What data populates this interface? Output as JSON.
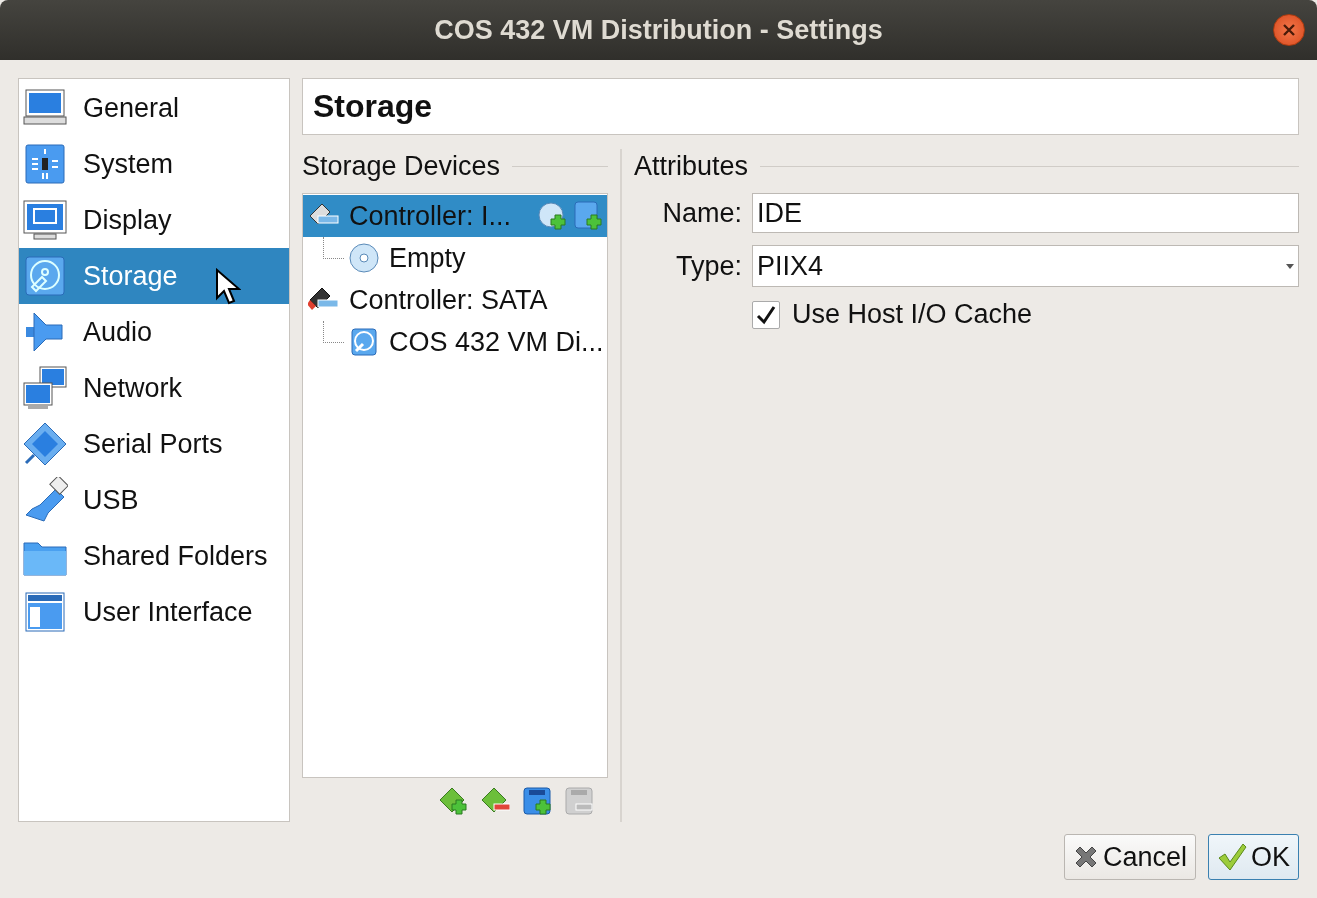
{
  "window": {
    "title": "COS 432 VM Distribution - Settings"
  },
  "sidebar": {
    "items": [
      {
        "label": "General",
        "selected": false
      },
      {
        "label": "System",
        "selected": false
      },
      {
        "label": "Display",
        "selected": false
      },
      {
        "label": "Storage",
        "selected": true
      },
      {
        "label": "Audio",
        "selected": false
      },
      {
        "label": "Network",
        "selected": false
      },
      {
        "label": "Serial Ports",
        "selected": false
      },
      {
        "label": "USB",
        "selected": false
      },
      {
        "label": "Shared Folders",
        "selected": false
      },
      {
        "label": "User Interface",
        "selected": false
      }
    ]
  },
  "page_title": "Storage",
  "storage_devices": {
    "title": "Storage Devices",
    "tree": [
      {
        "kind": "controller",
        "label": "Controller: I...",
        "selected": true,
        "children": [
          {
            "kind": "optical",
            "label": "Empty",
            "selected": false
          }
        ]
      },
      {
        "kind": "controller",
        "label": "Controller: SATA",
        "selected": false,
        "children": [
          {
            "kind": "hard-disk",
            "label": "COS 432 VM Di...",
            "selected": false
          }
        ]
      }
    ],
    "toolbar": [
      {
        "kind": "add-controller",
        "disabled": false
      },
      {
        "kind": "remove-controller",
        "disabled": false
      },
      {
        "kind": "add-attachment",
        "disabled": false
      },
      {
        "kind": "remove-attachment",
        "disabled": true
      }
    ]
  },
  "attributes": {
    "title": "Attributes",
    "name": {
      "label": "Name:",
      "value": "IDE"
    },
    "type": {
      "label": "Type:",
      "value": "PIIX4"
    },
    "host_io_cache": {
      "label": "Use Host I/O Cache",
      "checked": true
    }
  },
  "buttons": [
    {
      "kind": "cancel",
      "label": "Cancel",
      "default": false
    },
    {
      "kind": "ok",
      "label": "OK",
      "default": true
    }
  ]
}
